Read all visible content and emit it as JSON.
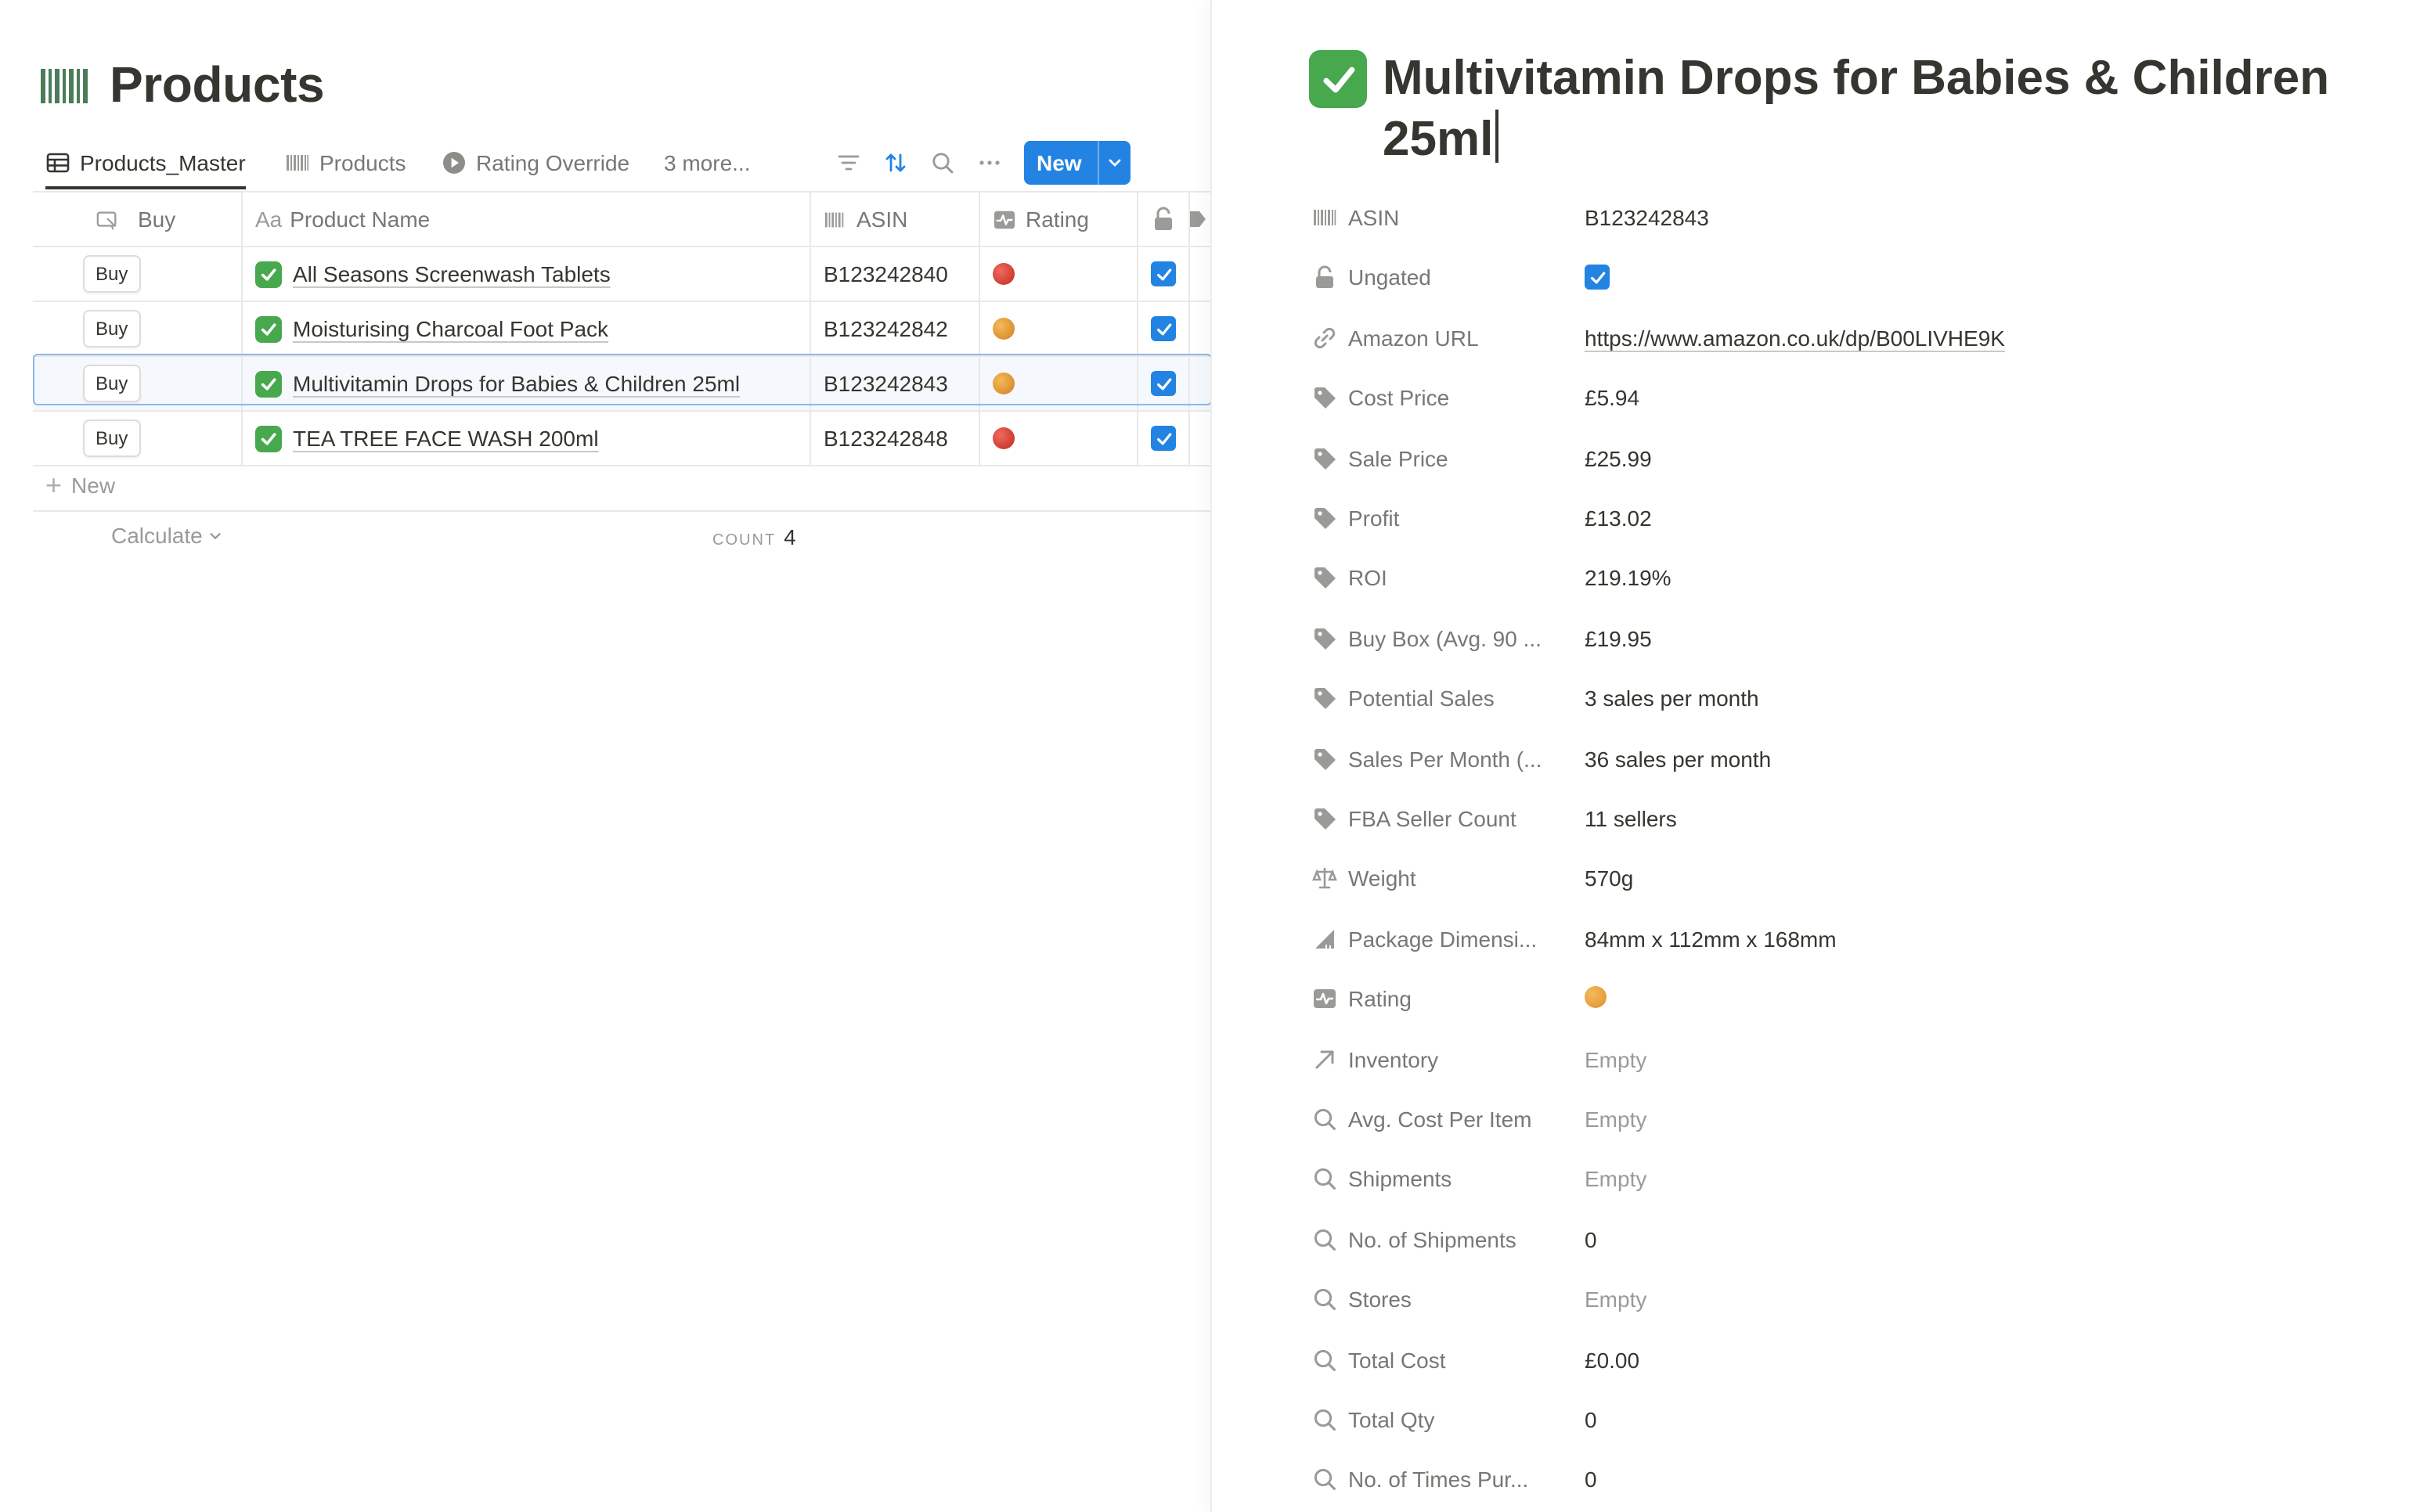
{
  "database": {
    "title": "Products",
    "tabs": [
      {
        "label": "Products_Master",
        "icon": "table-icon"
      },
      {
        "label": "Products",
        "icon": "barcode-icon"
      },
      {
        "label": "Rating Override",
        "icon": "play-circle-icon"
      },
      {
        "label": "3 more...",
        "icon": ""
      }
    ],
    "new_button": "New",
    "columns": {
      "buy": "Buy",
      "product_name": "Product Name",
      "asin": "ASIN",
      "rating": "Rating"
    },
    "rows": [
      {
        "buy": "Buy",
        "name": "All Seasons Screenwash Tablets",
        "asin": "B123242840",
        "rating_color": "#d0342c",
        "ungated": true
      },
      {
        "buy": "Buy",
        "name": "Moisturising Charcoal Foot Pack",
        "asin": "B123242842",
        "rating_color": "#e0902b",
        "ungated": true
      },
      {
        "buy": "Buy",
        "name": "Multivitamin Drops for Babies & Children 25ml",
        "asin": "B123242843",
        "rating_color": "#e0902b",
        "ungated": true,
        "selected": true
      },
      {
        "buy": "Buy",
        "name": "TEA TREE FACE WASH 200ml",
        "asin": "B123242848",
        "rating_color": "#d0342c",
        "ungated": true
      }
    ],
    "new_row_label": "New",
    "calculate_label": "Calculate",
    "count_label": "COUNT",
    "count_value": "4"
  },
  "panel": {
    "title": "Multivitamin Drops for Babies & Children 25ml",
    "properties": [
      {
        "icon": "barcode-icon",
        "label": "ASIN",
        "value": "B123242843"
      },
      {
        "icon": "lock-icon",
        "label": "Ungated",
        "value": "",
        "type": "checkbox",
        "checked": true
      },
      {
        "icon": "link-icon",
        "label": "Amazon URL",
        "value": "https://www.amazon.co.uk/dp/B00LIVHE9K",
        "type": "link"
      },
      {
        "icon": "tag-icon",
        "label": "Cost Price",
        "value": "£5.94"
      },
      {
        "icon": "tag-icon",
        "label": "Sale Price",
        "value": "£25.99"
      },
      {
        "icon": "tag-icon",
        "label": "Profit",
        "value": "£13.02"
      },
      {
        "icon": "tag-icon",
        "label": "ROI",
        "value": "219.19%"
      },
      {
        "icon": "tag-icon",
        "label": "Buy Box (Avg. 90 ...",
        "value": "£19.95"
      },
      {
        "icon": "tag-icon",
        "label": "Potential Sales",
        "value": "3 sales per month"
      },
      {
        "icon": "tag-icon",
        "label": "Sales Per Month (...",
        "value": "36 sales per month"
      },
      {
        "icon": "tag-icon",
        "label": "FBA Seller Count",
        "value": "11 sellers"
      },
      {
        "icon": "scale-icon",
        "label": "Weight",
        "value": "570g"
      },
      {
        "icon": "ruler-icon",
        "label": "Package Dimensi...",
        "value": "84mm x 112mm x 168mm"
      },
      {
        "icon": "activity-icon",
        "label": "Rating",
        "value": "",
        "type": "dot",
        "color": "#e0902b"
      },
      {
        "icon": "arrow-up-right-icon",
        "label": "Inventory",
        "value": "Empty",
        "type": "empty"
      },
      {
        "icon": "search-icon",
        "label": "Avg. Cost Per Item",
        "value": "Empty",
        "type": "empty"
      },
      {
        "icon": "search-icon",
        "label": "Shipments",
        "value": "Empty",
        "type": "empty"
      },
      {
        "icon": "search-icon",
        "label": "No. of Shipments",
        "value": "0"
      },
      {
        "icon": "search-icon",
        "label": "Stores",
        "value": "Empty",
        "type": "empty"
      },
      {
        "icon": "search-icon",
        "label": "Total Cost",
        "value": "£0.00"
      },
      {
        "icon": "search-icon",
        "label": "Total Qty",
        "value": "0"
      },
      {
        "icon": "search-icon",
        "label": "No. of Times Pur...",
        "value": "0"
      }
    ]
  },
  "colors": {
    "accent": "#2383e2",
    "check_emoji": "#47a84e",
    "rating_red": "#d0342c",
    "rating_orange": "#e0902b"
  }
}
